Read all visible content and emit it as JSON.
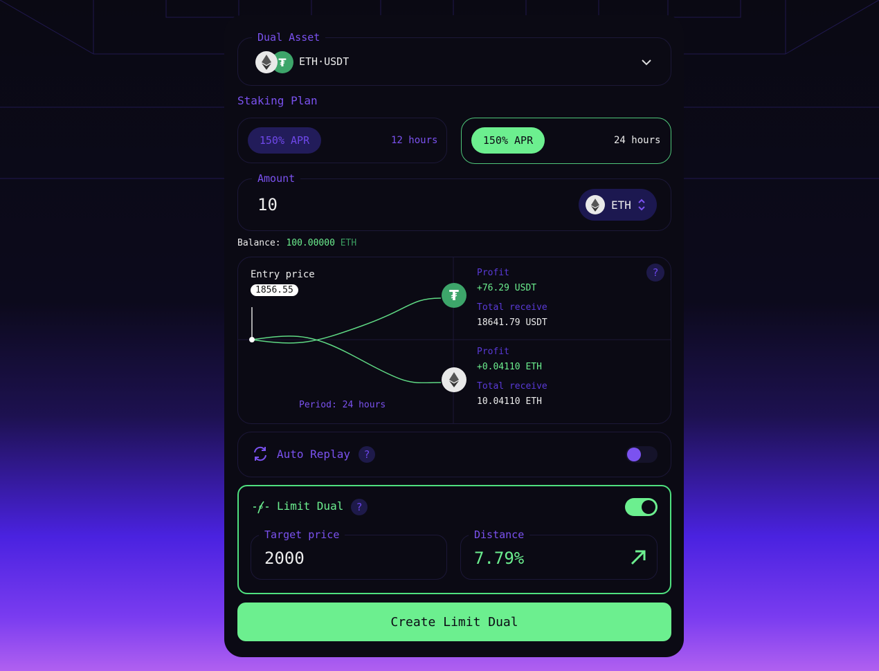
{
  "dual_asset": {
    "label": "Dual Asset",
    "pair": "ETH·USDT"
  },
  "staking": {
    "label": "Staking Plan",
    "plans": [
      {
        "apr": "150% APR",
        "duration": "12 hours",
        "selected": false
      },
      {
        "apr": "150% APR",
        "duration": "24 hours",
        "selected": true
      }
    ]
  },
  "amount": {
    "label": "Amount",
    "value": "10",
    "token": "ETH"
  },
  "balance": {
    "label": "Balance:",
    "value": "100.00000",
    "unit": "ETH"
  },
  "chart": {
    "entry_label": "Entry price",
    "entry_price": "1856.55",
    "period": "Period: 24 hours",
    "upper": {
      "profit_label": "Profit",
      "profit": "+76.29 USDT",
      "total_label": "Total receive",
      "total": "18641.79 USDT"
    },
    "lower": {
      "profit_label": "Profit",
      "profit": "+0.04110 ETH",
      "total_label": "Total receive",
      "total": "10.04110 ETH"
    }
  },
  "auto_replay": {
    "label": "Auto Replay",
    "help": "?",
    "enabled": false
  },
  "limit_dual": {
    "label": "Limit Dual",
    "help": "?",
    "enabled": true,
    "target_label": "Target price",
    "target": "2000",
    "distance_label": "Distance",
    "distance": "7.79%"
  },
  "create_button": "Create Limit Dual",
  "colors": {
    "accent_green": "#6cef8f",
    "accent_purple": "#7b52f0",
    "card_bg": "#0b0a14"
  }
}
